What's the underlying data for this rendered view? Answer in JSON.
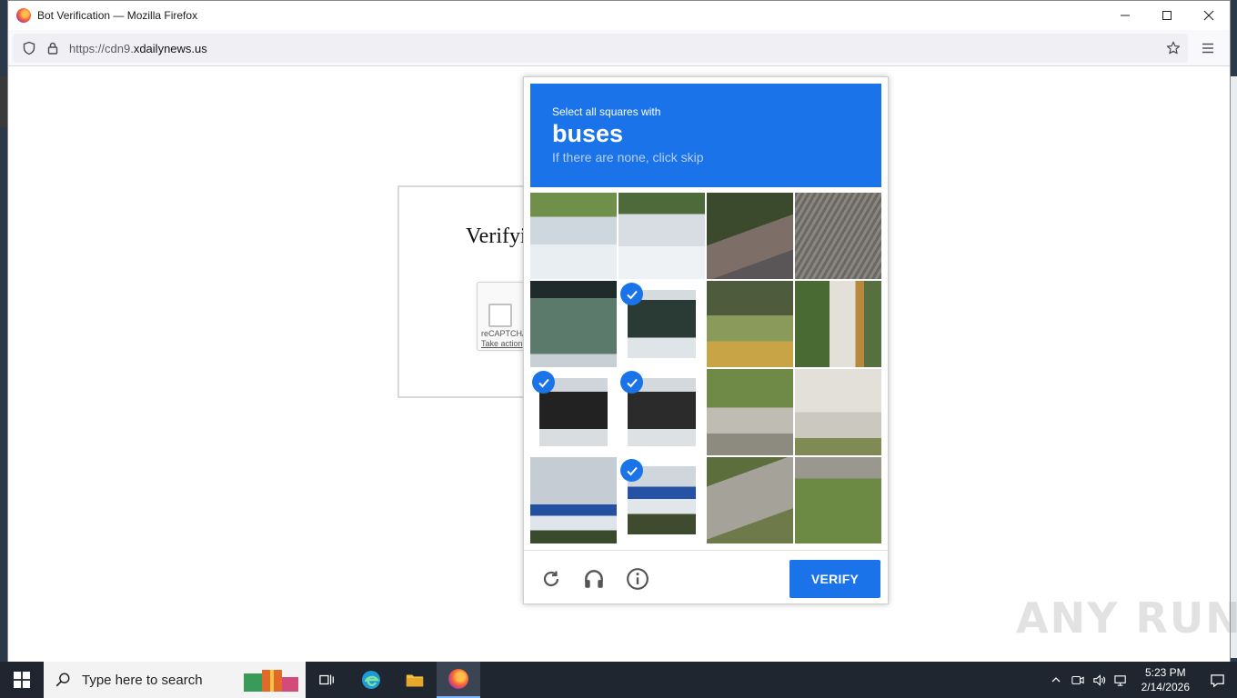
{
  "window": {
    "title": "Bot Verification — Mozilla Firefox"
  },
  "urlbar": {
    "prefix": "https://cdn9.",
    "domain": "xdailynews.us"
  },
  "page": {
    "heading": "Verifyi",
    "recaptcha_brand": "reCAPTCHA",
    "recaptcha_link": "Take action"
  },
  "challenge": {
    "prompt": "Select all squares with",
    "target": "buses",
    "skip_hint": "If there are none, click skip",
    "verify_label": "VERIFY",
    "tiles": [
      {
        "selected": false
      },
      {
        "selected": false
      },
      {
        "selected": false
      },
      {
        "selected": false
      },
      {
        "selected": false
      },
      {
        "selected": true
      },
      {
        "selected": false
      },
      {
        "selected": false
      },
      {
        "selected": true
      },
      {
        "selected": true
      },
      {
        "selected": false
      },
      {
        "selected": false
      },
      {
        "selected": false
      },
      {
        "selected": true
      },
      {
        "selected": false
      },
      {
        "selected": false
      }
    ],
    "footer_icons": [
      "reload-icon",
      "audio-icon",
      "info-icon"
    ]
  },
  "watermark": "ANY RUN",
  "taskbar": {
    "search_placeholder": "Type here to search",
    "time": "5:23 PM",
    "date": "2/14/2026"
  },
  "colors": {
    "accent": "#1a73e8",
    "taskbar": "#1f2630"
  }
}
